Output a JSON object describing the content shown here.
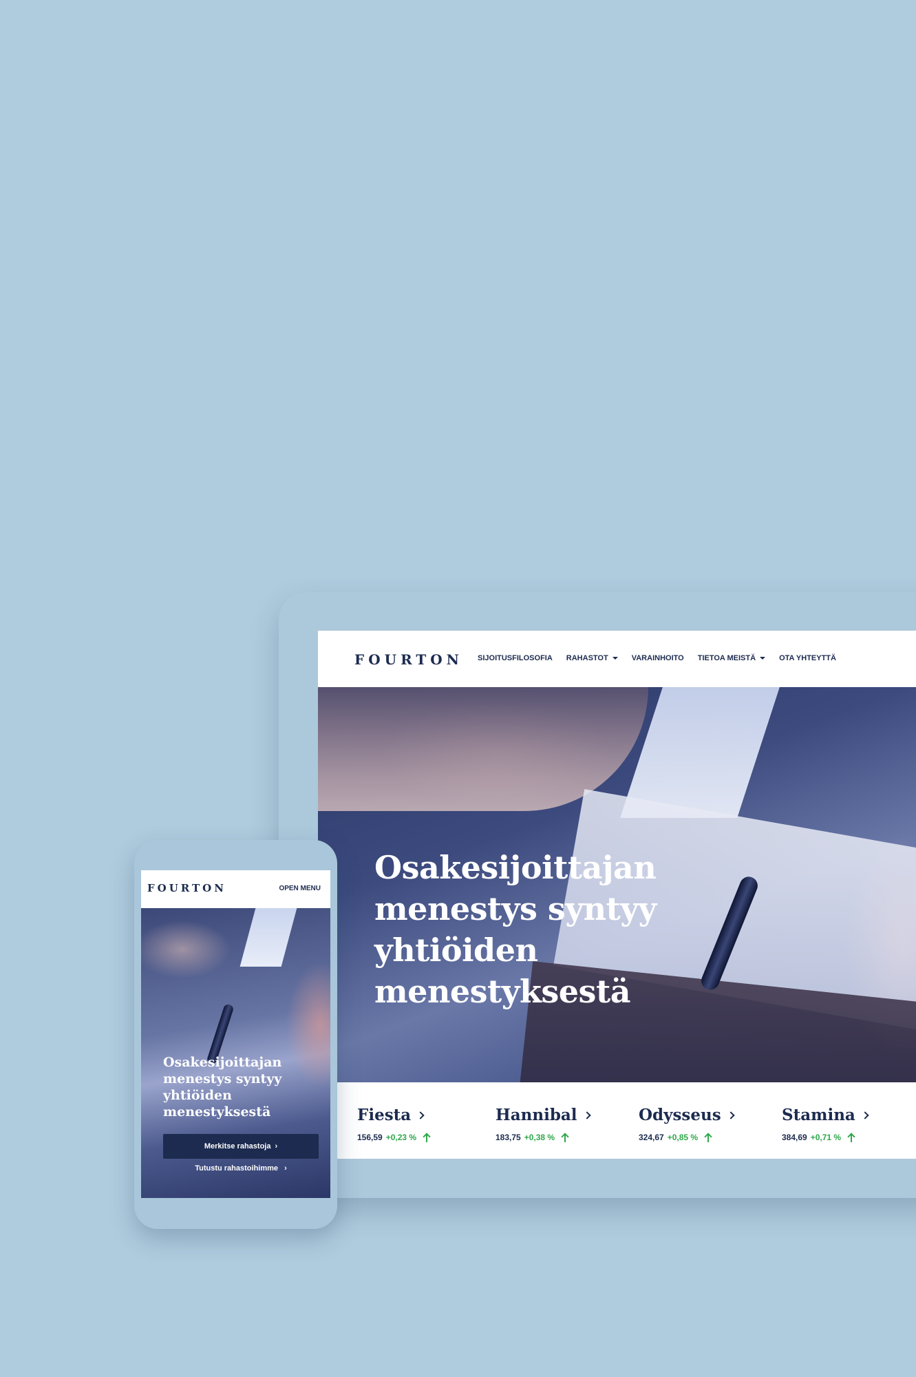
{
  "colors": {
    "background": "#afcbde",
    "navy": "#1c2b4f",
    "positive": "#2ea84a"
  },
  "desktop": {
    "logo": "FOURTON",
    "nav": [
      {
        "label": "SIJOITUSFILOSOFIA",
        "dropdown": false
      },
      {
        "label": "RAHASTOT",
        "dropdown": true
      },
      {
        "label": "VARAINHOITO",
        "dropdown": false
      },
      {
        "label": "TIETOA MEISTÄ",
        "dropdown": true
      },
      {
        "label": "OTA YHTEYTTÄ",
        "dropdown": false
      }
    ],
    "hero_title": "Osakesijoittajan menestys syntyy yhtiöiden menestyksestä",
    "funds": [
      {
        "name": "Fiesta",
        "price": "156,59",
        "change": "+0,23 %",
        "trend": "up"
      },
      {
        "name": "Hannibal",
        "price": "183,75",
        "change": "+0,38 %",
        "trend": "up"
      },
      {
        "name": "Odysseus",
        "price": "324,67",
        "change": "+0,85 %",
        "trend": "up"
      },
      {
        "name": "Stamina",
        "price": "384,69",
        "change": "+0,71 %",
        "trend": "up"
      }
    ]
  },
  "mobile": {
    "logo": "FOURTON",
    "menu_label": "OPEN MENU",
    "hero_title": "Osakesijoittajan menestys syntyy yhtiöiden menestyksestä",
    "primary_button": "Merkitse rahastoja",
    "secondary_link": "Tutustu rahastoihimme"
  }
}
